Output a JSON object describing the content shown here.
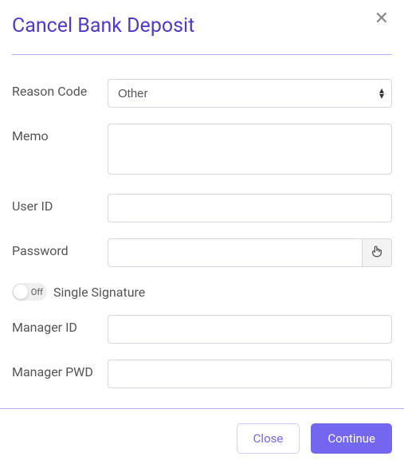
{
  "modal": {
    "title": "Cancel Bank Deposit"
  },
  "form": {
    "reason_code": {
      "label": "Reason Code",
      "value": "Other"
    },
    "memo": {
      "label": "Memo",
      "value": ""
    },
    "user_id": {
      "label": "User ID",
      "value": ""
    },
    "password": {
      "label": "Password",
      "value": ""
    },
    "single_signature": {
      "label": "Single Signature",
      "state_text": "Off",
      "enabled": false
    },
    "manager_id": {
      "label": "Manager ID",
      "value": ""
    },
    "manager_pwd": {
      "label": "Manager PWD",
      "value": ""
    }
  },
  "footer": {
    "close_label": "Close",
    "continue_label": "Continue"
  }
}
